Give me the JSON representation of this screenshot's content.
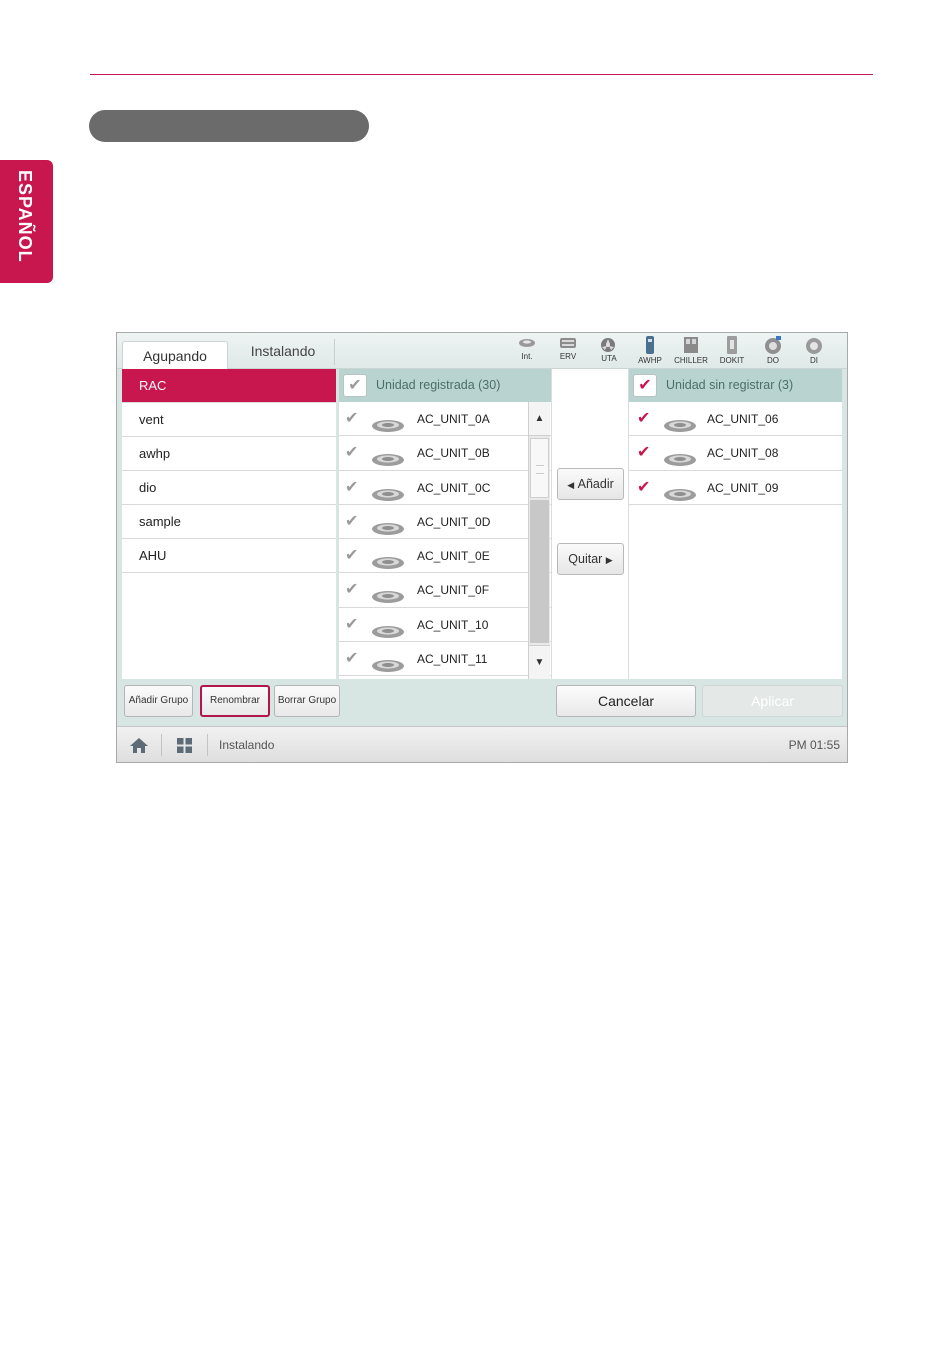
{
  "side_tab": {
    "language": "ESPAÑOL"
  },
  "screen": {
    "tabs": [
      {
        "label": "Agupando",
        "active": true
      },
      {
        "label": "Instalando",
        "active": false
      }
    ],
    "device_icons": [
      {
        "icon": "indoor-unit-icon",
        "label": "Int."
      },
      {
        "icon": "erv-icon",
        "label": "ERV"
      },
      {
        "icon": "uta-fan-icon",
        "label": "UTA"
      },
      {
        "icon": "awhp-icon",
        "label": "AWHP"
      },
      {
        "icon": "chiller-icon",
        "label": "CHILLER"
      },
      {
        "icon": "dokit-icon",
        "label": "DOKIT"
      },
      {
        "icon": "do-gear-icon",
        "label": "DO"
      },
      {
        "icon": "di-gear-icon",
        "label": "DI"
      }
    ],
    "groups": [
      "RAC",
      "vent",
      "awhp",
      "dio",
      "sample",
      "AHU"
    ],
    "selected_group": "RAC",
    "registered": {
      "header": "Unidad registrada (30)",
      "units": [
        "AC_UNIT_0A",
        "AC_UNIT_0B",
        "AC_UNIT_0C",
        "AC_UNIT_0D",
        "AC_UNIT_0E",
        "AC_UNIT_0F",
        "AC_UNIT_10",
        "AC_UNIT_11"
      ]
    },
    "unregistered": {
      "header": "Unidad sin registrar (3)",
      "units": [
        "AC_UNIT_06",
        "AC_UNIT_08",
        "AC_UNIT_09"
      ]
    },
    "middle_buttons": {
      "add": "Añadir",
      "remove": "Quitar"
    },
    "group_buttons": {
      "add": "Añadir Grupo",
      "rename": "Renombrar",
      "delete": "Borrar Grupo"
    },
    "actions": {
      "cancel": "Cancelar",
      "apply": "Aplicar"
    },
    "footer": {
      "breadcrumb": "Instalando",
      "time": "PM 01:55"
    },
    "colors": {
      "accent": "#c8174f",
      "panel": "#d7e6e3",
      "header": "#b9d4d0"
    }
  }
}
